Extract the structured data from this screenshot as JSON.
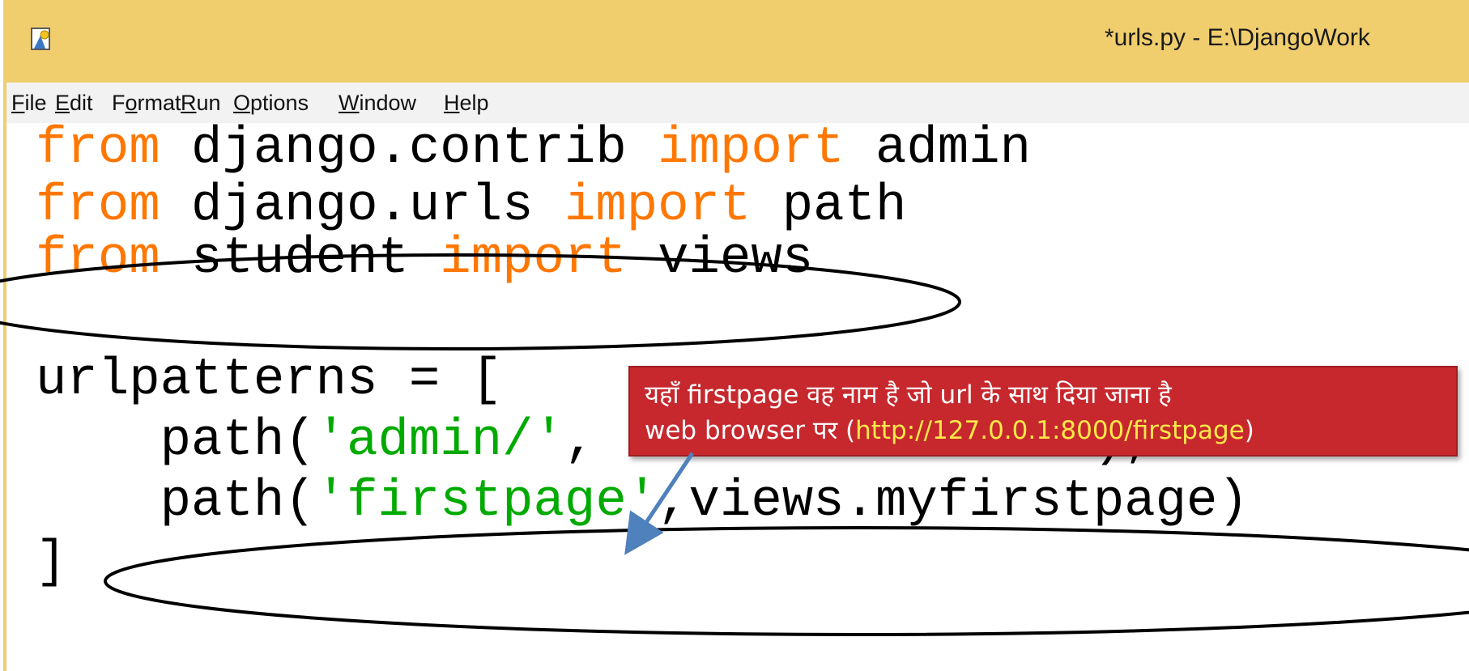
{
  "window": {
    "title": "*urls.py - E:\\DjangoWork"
  },
  "menu": {
    "items": [
      {
        "pre": "",
        "u": "F",
        "post": "ile"
      },
      {
        "pre": "",
        "u": "E",
        "post": "dit"
      },
      {
        "pre": "F",
        "u": "o",
        "post": "rmat"
      },
      {
        "pre": "",
        "u": "R",
        "post": "un"
      },
      {
        "pre": "",
        "u": "O",
        "post": "ptions"
      },
      {
        "pre": "",
        "u": "W",
        "post": "indow"
      },
      {
        "pre": "",
        "u": "H",
        "post": "elp"
      }
    ]
  },
  "code": {
    "lines": [
      [
        {
          "t": "from",
          "c": "kw"
        },
        {
          "t": " django.contrib ",
          "c": ""
        },
        {
          "t": "import",
          "c": "kw"
        },
        {
          "t": " admin",
          "c": ""
        }
      ],
      [
        {
          "t": "from",
          "c": "kw"
        },
        {
          "t": " django.urls ",
          "c": ""
        },
        {
          "t": "import",
          "c": "kw"
        },
        {
          "t": " path",
          "c": ""
        }
      ],
      [
        {
          "t": "from",
          "c": "kw"
        },
        {
          "t": " student ",
          "c": ""
        },
        {
          "t": "import",
          "c": "kw"
        },
        {
          "t": " views",
          "c": ""
        }
      ],
      [],
      [
        {
          "t": "urlpatterns = [",
          "c": ""
        }
      ],
      [
        {
          "t": "    path(",
          "c": ""
        },
        {
          "t": "'admin/'",
          "c": "str"
        },
        {
          "t": ", admin.site.urls),",
          "c": ""
        }
      ],
      [
        {
          "t": "    path(",
          "c": ""
        },
        {
          "t": "'firstpage'",
          "c": "str"
        },
        {
          "t": ",views.myfirstpage)",
          "c": ""
        }
      ],
      [
        {
          "t": "]",
          "c": ""
        }
      ]
    ]
  },
  "annotation": {
    "line1": "यहाँ firstpage वह नाम है जो url के साथ दिया जाना है",
    "line2_prefix": "web browser पर (",
    "line2_url": "http://127.0.0.1:8000/firstpage",
    "line2_suffix": ")"
  },
  "colors": {
    "titlebar": "#f0ce6e",
    "keyword": "#ff7700",
    "string": "#00aa00",
    "callout_bg": "#c6282d",
    "callout_url": "#ffe84a",
    "arrow": "#4f81bd"
  }
}
